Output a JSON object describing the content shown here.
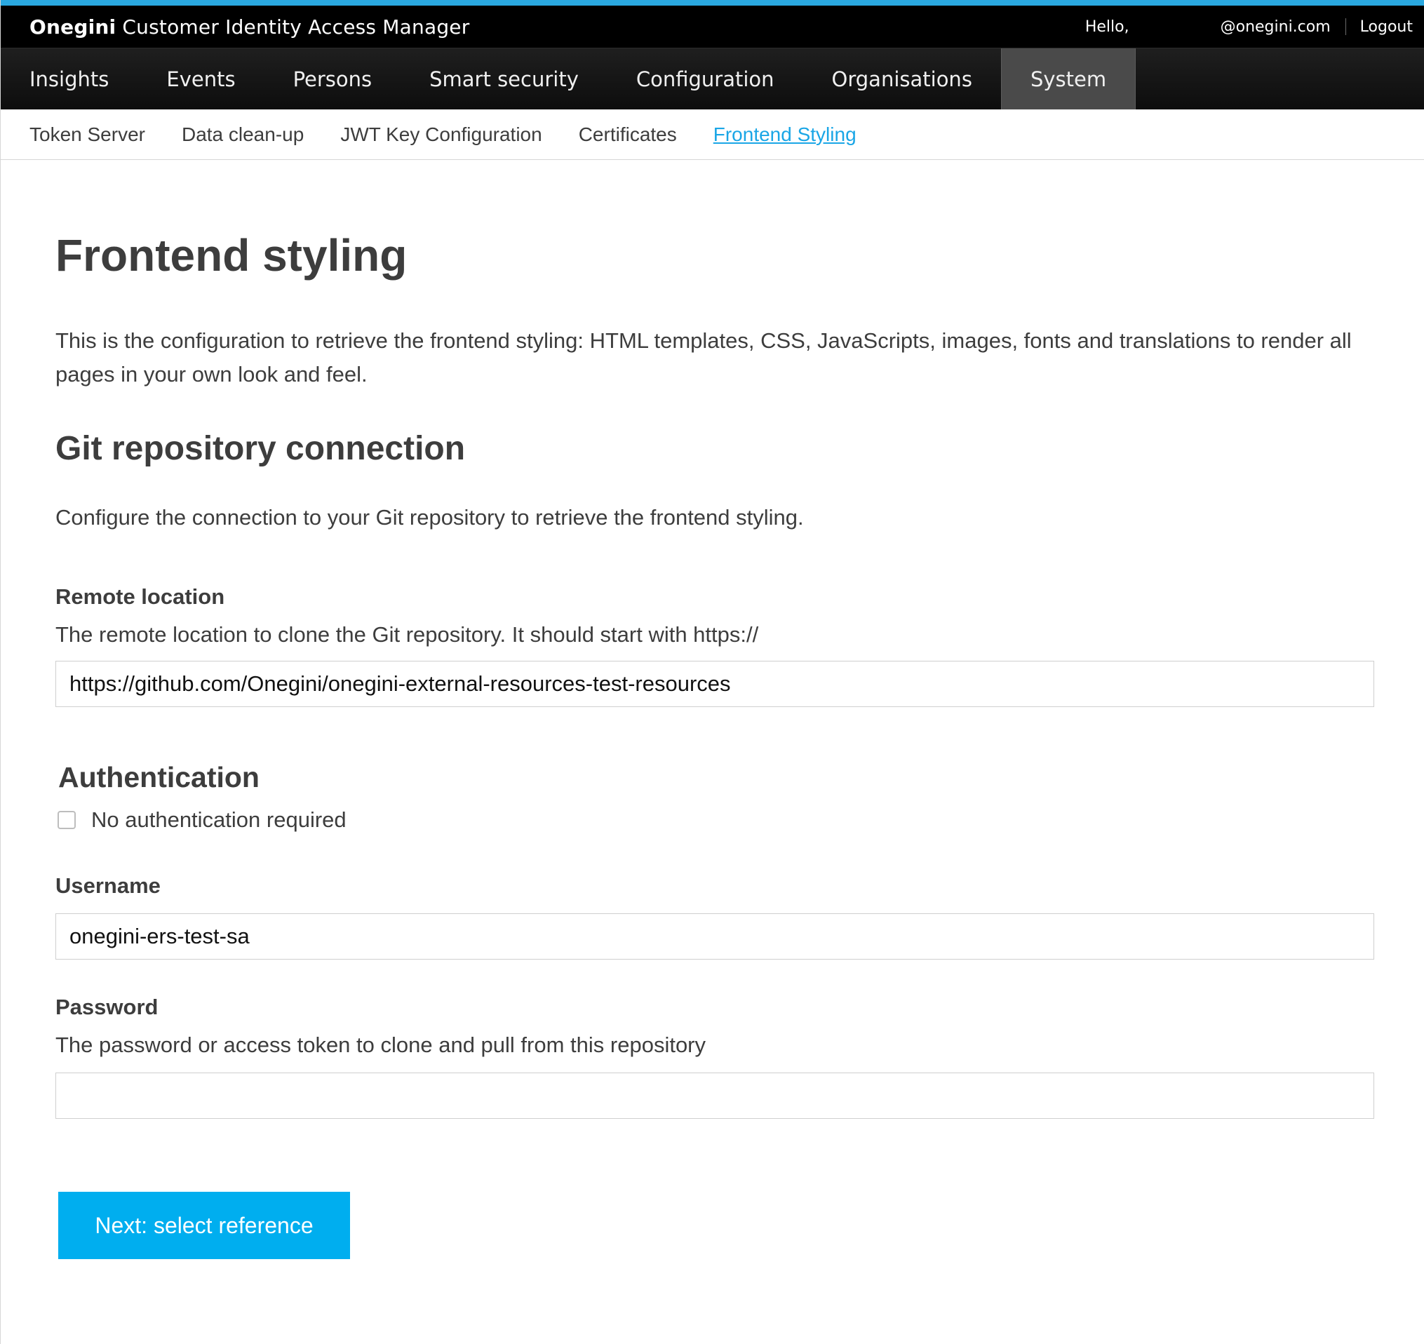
{
  "app": {
    "brand_name": "Onegini",
    "product_name": "Customer Identity Access Manager",
    "greeting": "Hello,",
    "user_email": "@onegini.com",
    "logout_label": "Logout"
  },
  "main_nav": {
    "items": [
      {
        "label": "Insights"
      },
      {
        "label": "Events"
      },
      {
        "label": "Persons"
      },
      {
        "label": "Smart security"
      },
      {
        "label": "Configuration"
      },
      {
        "label": "Organisations"
      },
      {
        "label": "System"
      }
    ],
    "active": "System"
  },
  "sub_nav": {
    "items": [
      {
        "label": "Token Server"
      },
      {
        "label": "Data clean-up"
      },
      {
        "label": "JWT Key Configuration"
      },
      {
        "label": "Certificates"
      },
      {
        "label": "Frontend Styling"
      }
    ],
    "active": "Frontend Styling"
  },
  "page": {
    "title": "Frontend styling",
    "intro": "This is the configuration to retrieve the frontend styling: HTML templates, CSS, JavaScripts, images, fonts and translations to render all pages in your own look and feel."
  },
  "git_section": {
    "title": "Git repository connection",
    "description": "Configure the connection to your Git repository to retrieve the frontend styling."
  },
  "remote_location": {
    "label": "Remote location",
    "help": "The remote location to clone the Git repository. It should start with https://",
    "value": "https://github.com/Onegini/onegini-external-resources-test-resources"
  },
  "authentication": {
    "title": "Authentication",
    "no_auth_label": "No authentication required",
    "no_auth_checked": false
  },
  "username": {
    "label": "Username",
    "value": "onegini-ers-test-sa"
  },
  "password": {
    "label": "Password",
    "help": "The password or access token to clone and pull from this repository",
    "value": ""
  },
  "actions": {
    "next_label": "Next: select reference"
  },
  "colors": {
    "accent": "#00aeef",
    "link_active": "#1aa6e6",
    "top_bar": "#000000",
    "nav_active": "#4a4a4a"
  }
}
